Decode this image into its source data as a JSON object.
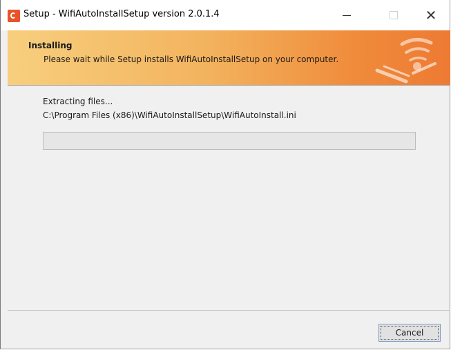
{
  "window": {
    "title": "Setup - WifiAutoInstallSetup version 2.0.1.4",
    "icon": "setup-app-icon"
  },
  "title_controls": {
    "minimize": "—",
    "maximize": "□",
    "close": "✕"
  },
  "header": {
    "title": "Installing",
    "subtitle": "Please wait while Setup installs WifiAutoInstallSetup on your computer.",
    "gradient_colors": [
      "#f7cf7e",
      "#ef8a3a"
    ]
  },
  "body": {
    "status": "Extracting files...",
    "path": "C:\\Program Files (x86)\\WifiAutoInstallSetup\\WifiAutoInstall.ini",
    "progress_fraction": 0
  },
  "footer": {
    "cancel_label": "Cancel"
  }
}
